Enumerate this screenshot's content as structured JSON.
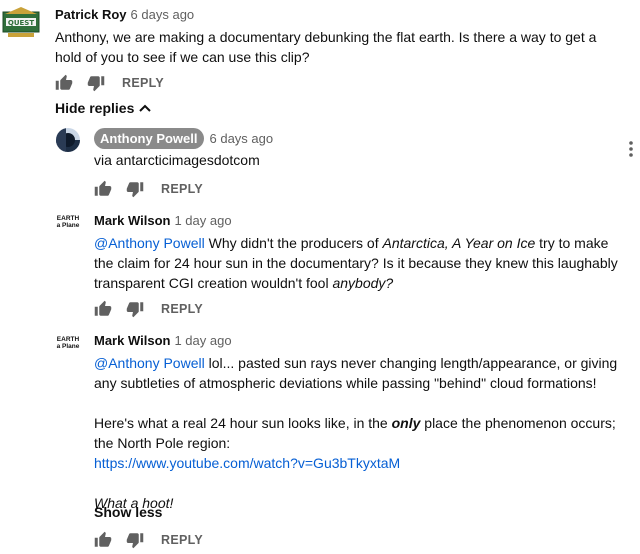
{
  "comments": [
    {
      "author": "Patrick Roy",
      "time": "6 days ago",
      "text_lines": [
        "Anthony, we are making a documentary debunking the flat earth. Is there a way to get a",
        "hold of you to see if we can use this clip?"
      ],
      "reply_label": "REPLY"
    }
  ],
  "hide_replies_label": "Hide replies",
  "replies": [
    {
      "author": "Anthony Powell",
      "time": "6 days ago",
      "text": "via antarcticimagesdotcom",
      "reply_label": "REPLY"
    },
    {
      "author": "Mark Wilson",
      "time": "1 day ago",
      "avatar_text": [
        "EARTH",
        "a Plane"
      ],
      "mention": "@Anthony Powell",
      "line1_rest": " Why didn't the producers of ",
      "line1_italic": "Antarctica, A Year on Ice",
      "line1_end": " try to make",
      "line2": "the claim for 24 hour sun in the documentary? Is it because they knew this laughably",
      "line3_start": "transparent CGI creation wouldn't fool ",
      "line3_italic": "anybody?",
      "reply_label": "REPLY"
    },
    {
      "author": "Mark Wilson",
      "time": "1 day ago",
      "avatar_text": [
        "EARTH",
        "a Plane"
      ],
      "mention": "@Anthony Powell",
      "line1_rest": " lol... pasted sun rays never changing length/appearance, or giving",
      "line2": "any subtleties of atmospheric deviations while passing \"behind\" cloud formations!",
      "line3_start": "Here's what a real 24 hour sun looks like, in the ",
      "line3_bold_italic": "only",
      "line3_end": " place the phenomenon occurs;",
      "line4": "the North Pole region:",
      "link": "https://www.youtube.com/watch?v=Gu3bTkyxtaM",
      "closing_italic": "What a hoot!",
      "show_less_label": "Show less",
      "reply_label": "REPLY"
    }
  ],
  "colors": {
    "link": "#065fd4",
    "meta": "#606060",
    "chip": "#8a8a8a"
  }
}
